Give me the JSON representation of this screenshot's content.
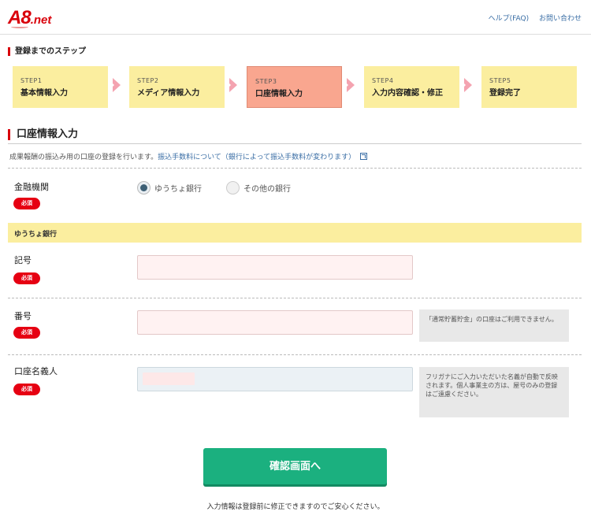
{
  "header": {
    "logo_main": "A8",
    "logo_suffix": ".net",
    "help_link": "ヘルプ(FAQ)",
    "contact_link": "お問い合わせ"
  },
  "steps_heading": "登録までのステップ",
  "steps": [
    {
      "num": "STEP1",
      "name": "基本情報入力"
    },
    {
      "num": "STEP2",
      "name": "メディア情報入力"
    },
    {
      "num": "STEP3",
      "name": "口座情報入力"
    },
    {
      "num": "STEP4",
      "name": "入力内容確認・修正"
    },
    {
      "num": "STEP5",
      "name": "登録完了"
    }
  ],
  "active_step": "STEP3",
  "form_title": "口座情報入力",
  "intro_text": "成果報酬の振込み用の口座の登録を行います。",
  "intro_link": "振込手数料について（銀行によって振込手数料が変わります）",
  "bank": {
    "label": "金融機関",
    "required": "必須",
    "option_yucho": "ゆうちょ銀行",
    "option_other": "その他の銀行",
    "selected": "ゆうちょ銀行"
  },
  "section_band": "ゆうちょ銀行",
  "kigou": {
    "label": "記号",
    "required": "必須",
    "value": ""
  },
  "bangou": {
    "label": "番号",
    "required": "必須",
    "value": "",
    "note": "「通常貯蓄貯金」の口座はご利用できません。"
  },
  "holder": {
    "label": "口座名義人",
    "required": "必須",
    "value": "",
    "note": "フリガナにご入力いただいた名義が自動で反映されます。個人事業主の方は、屋号のみの登録はご遠慮ください。"
  },
  "confirm_button": "確認画面へ",
  "footnote": "入力情報は登録前に修正できますのでご安心ください。",
  "colors": {
    "brand": "#d9000b",
    "step": "#fbee9f",
    "step_active": "#f9a68f",
    "confirm": "#1bb07f"
  }
}
